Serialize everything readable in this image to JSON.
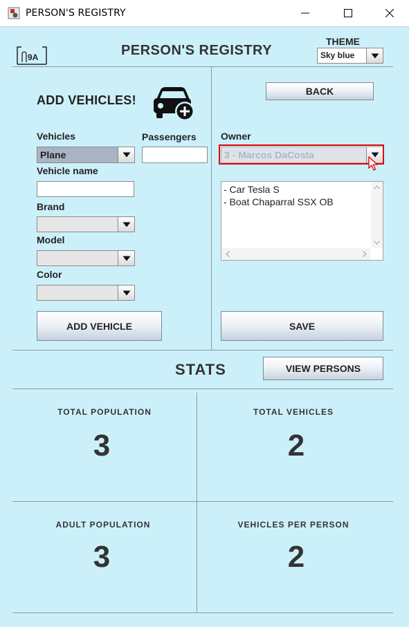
{
  "window": {
    "title": "PERSON'S REGISTRY"
  },
  "header": {
    "title": "PERSON'S REGISTRY",
    "logo_text": "9A",
    "theme_label": "THEME",
    "theme_value": "Sky blue"
  },
  "add_vehicle": {
    "title": "ADD VEHICLES!",
    "vehicles_label": "Vehicles",
    "vehicles_value": "Plane",
    "passengers_label": "Passengers",
    "passengers_value": "",
    "vehicle_name_label": "Vehicle name",
    "vehicle_name_value": "",
    "brand_label": "Brand",
    "brand_value": "",
    "model_label": "Model",
    "model_value": "",
    "color_label": "Color",
    "color_value": "",
    "add_button": "ADD VEHICLE"
  },
  "owner_panel": {
    "back_button": "BACK",
    "owner_label": "Owner",
    "owner_value": "3 - Marcos DaCosta",
    "vehicle_list": [
      "- Car Tesla S",
      "- Boat Chaparral SSX OB"
    ],
    "save_button": "SAVE"
  },
  "stats": {
    "title": "STATS",
    "view_persons_button": "VIEW PERSONS",
    "total_population_label": "TOTAL POPULATION",
    "total_population": "3",
    "total_vehicles_label": "TOTAL VEHICLES",
    "total_vehicles": "2",
    "adult_population_label": "ADULT POPULATION",
    "adult_population": "3",
    "vehicles_per_person_label": "VEHICLES PER PERSON",
    "vehicles_per_person": "2"
  },
  "colors": {
    "background": "#ccf0fa",
    "highlight": "#e00000",
    "selected_combo": "#a8b4c4"
  }
}
